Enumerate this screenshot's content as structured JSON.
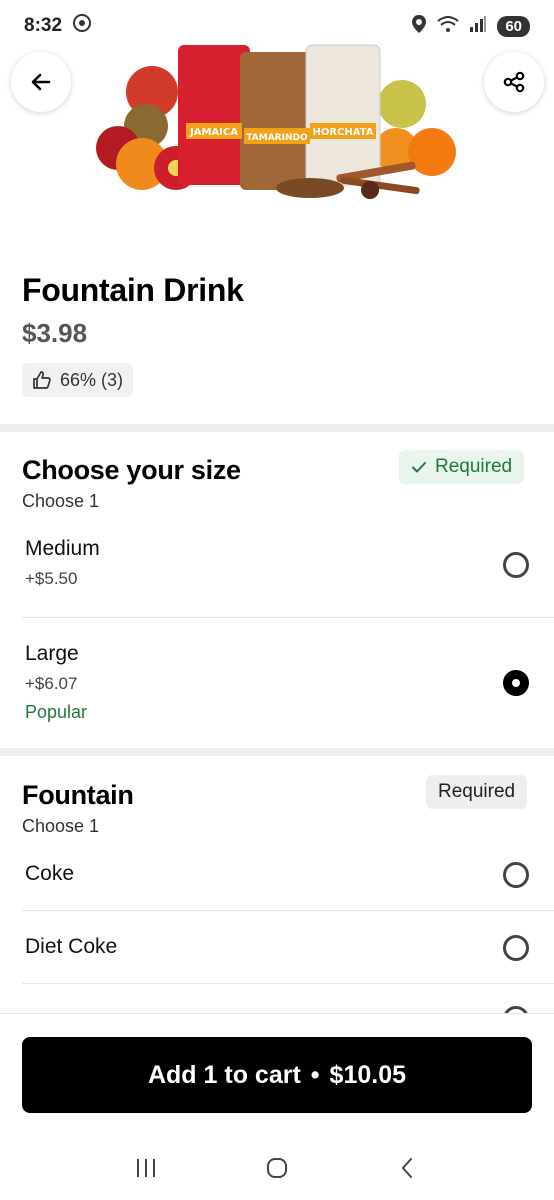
{
  "status": {
    "time": "8:32",
    "battery": "60"
  },
  "hero": {
    "drink_labels": [
      "JAMAICA",
      "TAMARINDO",
      "HORCHATA"
    ]
  },
  "item": {
    "title": "Fountain Drink",
    "price": "$3.98",
    "rating": "66% (3)"
  },
  "size_section": {
    "title": "Choose your size",
    "subtitle": "Choose 1",
    "badge": "Required",
    "options": [
      {
        "name": "Medium",
        "price": "+$5.50",
        "selected": false
      },
      {
        "name": "Large",
        "price": "+$6.07",
        "tag": "Popular",
        "selected": true
      }
    ]
  },
  "fountain_section": {
    "title": "Fountain",
    "subtitle": "Choose 1",
    "badge": "Required",
    "options": [
      {
        "name": "Coke",
        "selected": false
      },
      {
        "name": "Diet Coke",
        "selected": false
      }
    ]
  },
  "cart": {
    "label": "Add 1 to cart",
    "separator": "•",
    "total": "$10.05"
  },
  "colors": {
    "accent_green": "#1f7a3d",
    "button_black": "#000000"
  }
}
